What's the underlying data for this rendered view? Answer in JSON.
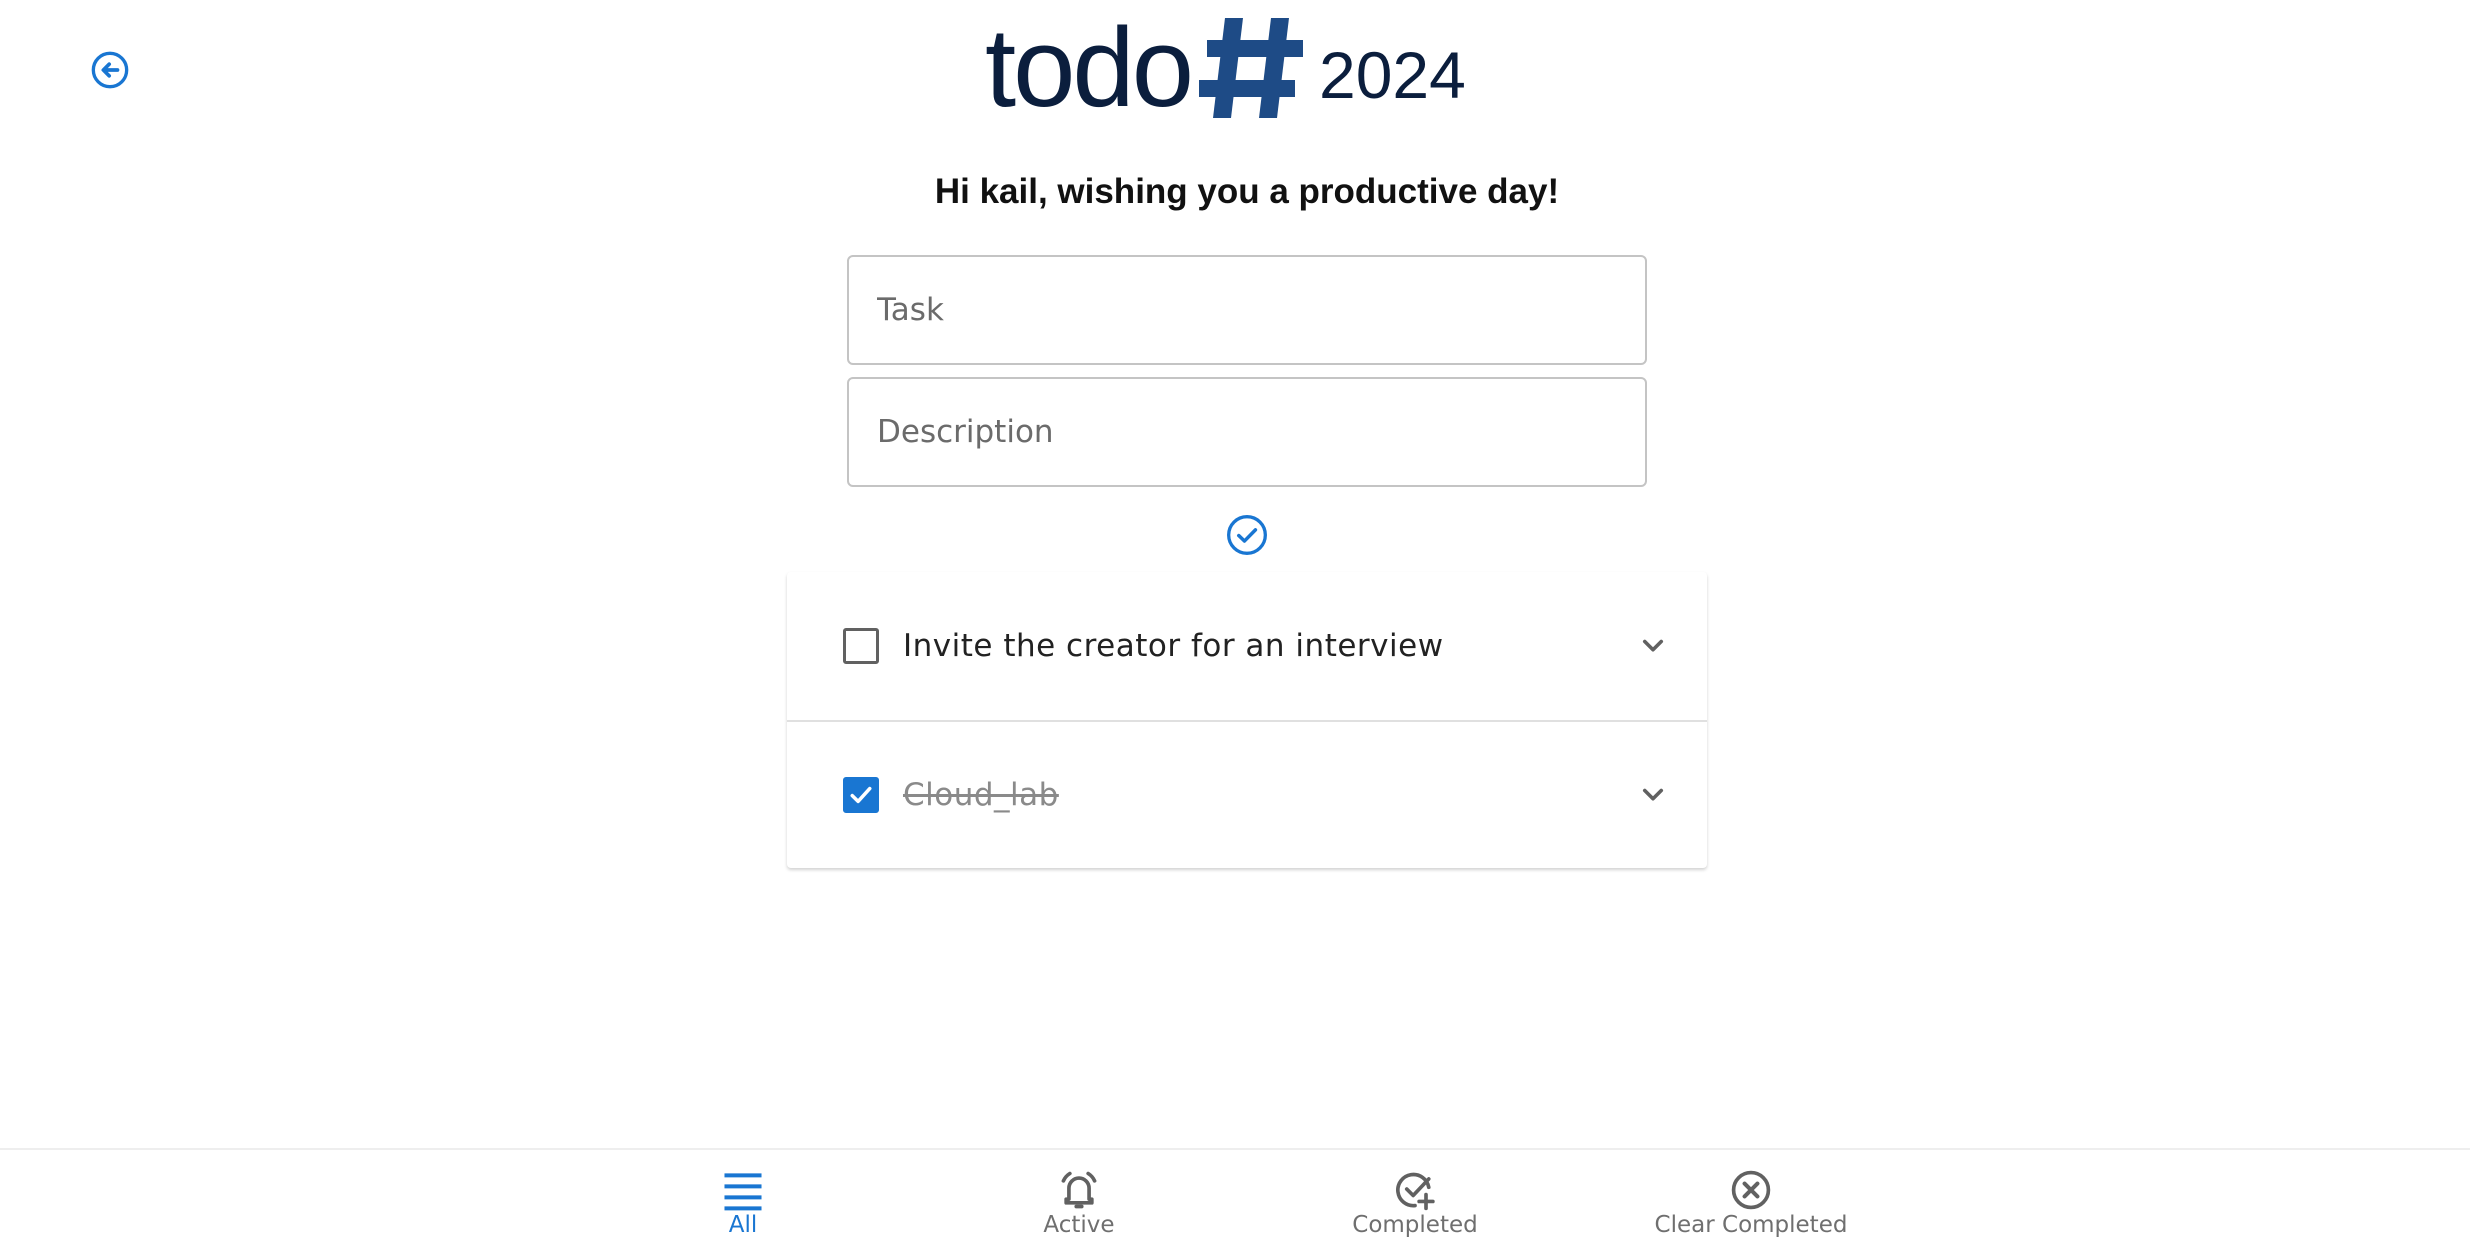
{
  "header": {
    "logo_word": "todo",
    "logo_year": "2024"
  },
  "greeting": "Hi kail, wishing you a productive day!",
  "form": {
    "task_placeholder": "Task",
    "description_placeholder": "Description",
    "task_value": "",
    "description_value": ""
  },
  "todos": [
    {
      "title": "Invite the creator for an interview",
      "completed": false
    },
    {
      "title": "Cloud_lab",
      "completed": true
    }
  ],
  "bottom_nav": {
    "items": [
      {
        "label": "All",
        "icon": "menu-icon",
        "selected": true
      },
      {
        "label": "Active",
        "icon": "alarm-bell-icon",
        "selected": false
      },
      {
        "label": "Completed",
        "icon": "check-plus-icon",
        "selected": false
      },
      {
        "label": "Clear Completed",
        "icon": "cancel-circle-icon",
        "selected": false
      }
    ]
  },
  "colors": {
    "accent": "#1976d2",
    "logo_dark": "#0b1e3d",
    "logo_hash": "#1e4b86"
  }
}
